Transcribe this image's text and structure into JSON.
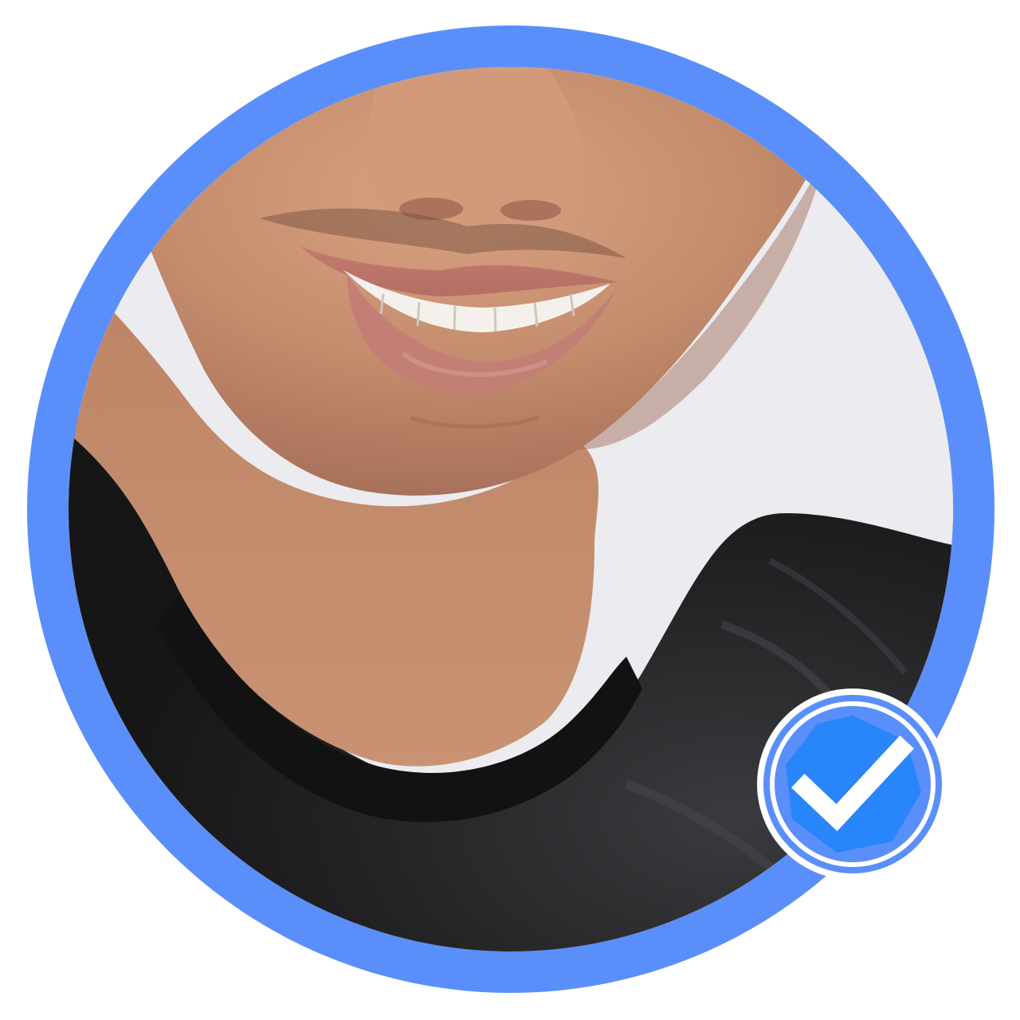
{
  "avatar": {
    "ring_color": "#5a8ffb",
    "background_color": "#ecebef",
    "skin_color": "#c99373",
    "sweater_color": "#1c1c1e",
    "lip_color": "#c9847a"
  },
  "verified_badge": {
    "icon": "verified-check-icon",
    "badge_color": "#2f8cff",
    "check_color": "#ffffff",
    "border_color": "#ffffff",
    "verified": true
  }
}
